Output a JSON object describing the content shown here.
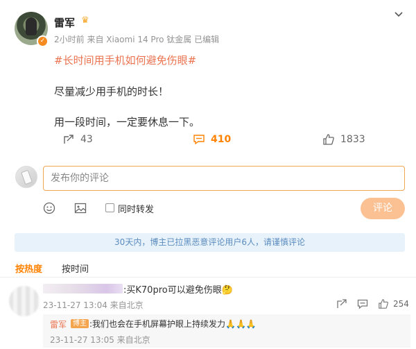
{
  "post": {
    "author": "雷军",
    "author_badge_icon": "crown-icon",
    "verify_icon": "verified-v-icon",
    "meta": "2小时前  来自 Xiaomi 14 Pro 钛金属  已编辑",
    "hashtag": "#长时间用手机如何避免伤眼#",
    "lines": [
      "尽量减少用手机的时长！",
      "用一段时间，一定要休息一下。"
    ],
    "actions": {
      "repost_count": "43",
      "comment_count": "410",
      "like_count": "1833"
    }
  },
  "composer": {
    "placeholder": "发布你的评论",
    "repost_label": "同时转发",
    "submit_label": "评论"
  },
  "notice": "30天内，博主已拉黑恶意评论用户6人，请谨慎评论",
  "sort": {
    "hot_label": "按热度",
    "time_label": "按时间"
  },
  "comments": [
    {
      "text": ":买K70pro可以避免伤眼🤔",
      "time": "23-11-27 13:04  来自北京",
      "like_count": "254",
      "reply": {
        "author": "雷军",
        "badge": "博主",
        "text": ":我们也会在手机屏幕护眼上持续发力🙏🙏🙏",
        "time": "23-11-27 13:05  来自北京"
      }
    }
  ],
  "colors": {
    "accent": "#ff8200",
    "hashtag": "#eb7350",
    "notice_bg": "#e8f2fa",
    "notice_text": "#5a8cbf",
    "submit_bg": "#fbc193"
  }
}
